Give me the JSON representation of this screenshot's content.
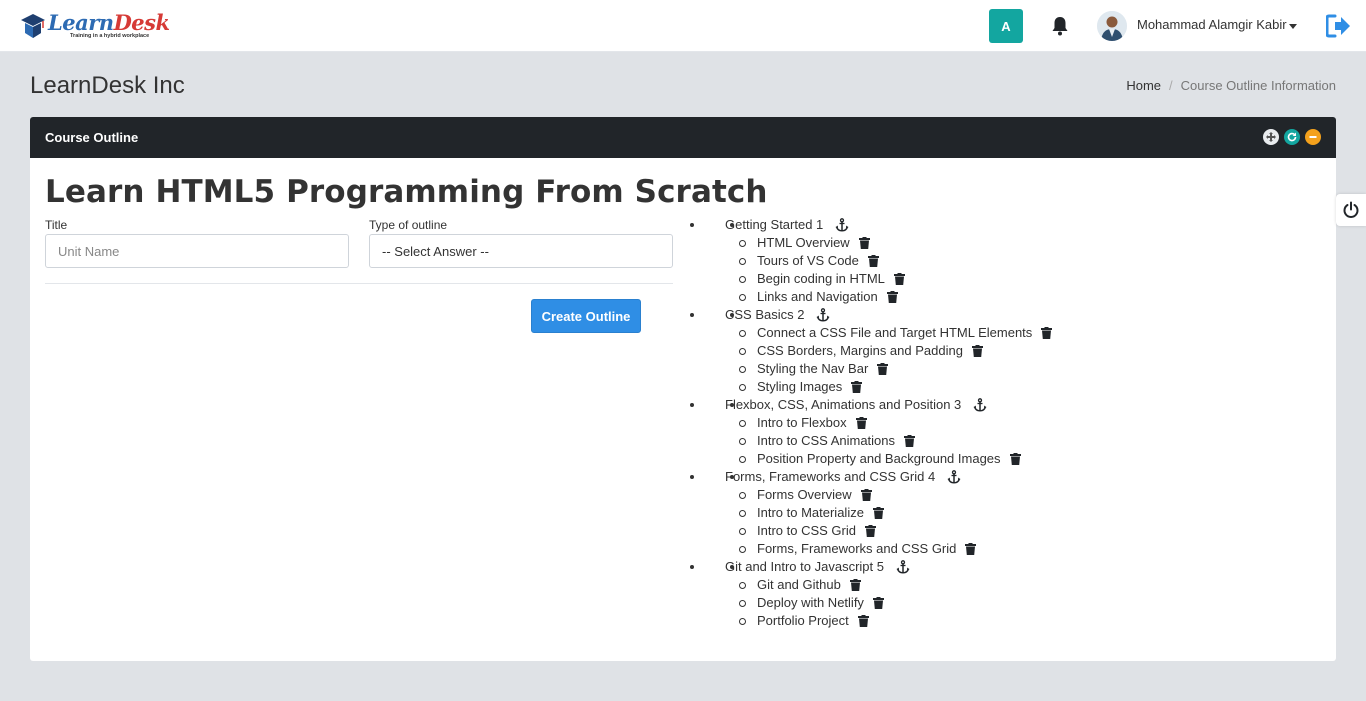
{
  "navbar": {
    "logo_part1": "Learn",
    "logo_part2": "Desk",
    "logo_tagline": "Training in a hybrid workplace",
    "avatar_initial": "A",
    "user_name": "Mohammad Alamgir Kabir"
  },
  "page": {
    "title": "LearnDesk Inc",
    "breadcrumb_home": "Home",
    "breadcrumb_sep": "/",
    "breadcrumb_current": "Course Outline Information"
  },
  "card": {
    "header_title": "Course Outline",
    "course_title": "Learn HTML5 Programming From Scratch",
    "form": {
      "title_label": "Title",
      "title_placeholder": "Unit Name",
      "type_label": "Type of outline",
      "type_selected": "-- Select Answer --",
      "create_button": "Create Outline"
    }
  },
  "outline": [
    {
      "unit": "Getting Started 1",
      "lessons": [
        "HTML Overview",
        "Tours of VS Code",
        "Begin coding in HTML",
        "Links and Navigation"
      ]
    },
    {
      "unit": "CSS Basics 2",
      "lessons": [
        "Connect a CSS File and Target HTML Elements",
        "CSS Borders, Margins and Padding",
        "Styling the Nav Bar",
        "Styling Images"
      ]
    },
    {
      "unit": "Flexbox, CSS, Animations and Position 3",
      "lessons": [
        "Intro to Flexbox",
        "Intro to CSS Animations",
        "Position Property and Background Images"
      ]
    },
    {
      "unit": "Forms, Frameworks and CSS Grid 4",
      "lessons": [
        "Forms Overview",
        "Intro to Materialize",
        "Intro to CSS Grid",
        "Forms, Frameworks and CSS Grid"
      ]
    },
    {
      "unit": "Git and Intro to Javascript 5",
      "lessons": [
        "Git and Github",
        "Deploy with Netlify",
        "Portfolio Project"
      ]
    }
  ],
  "icons": {
    "unit_icon": "anchor-icon",
    "lesson_icon": "trash-icon"
  },
  "colors": {
    "accent_teal": "#13a6a0",
    "primary_blue": "#2f8ee5",
    "header_dark": "#212529",
    "collapse_orange": "#f4a11c"
  }
}
